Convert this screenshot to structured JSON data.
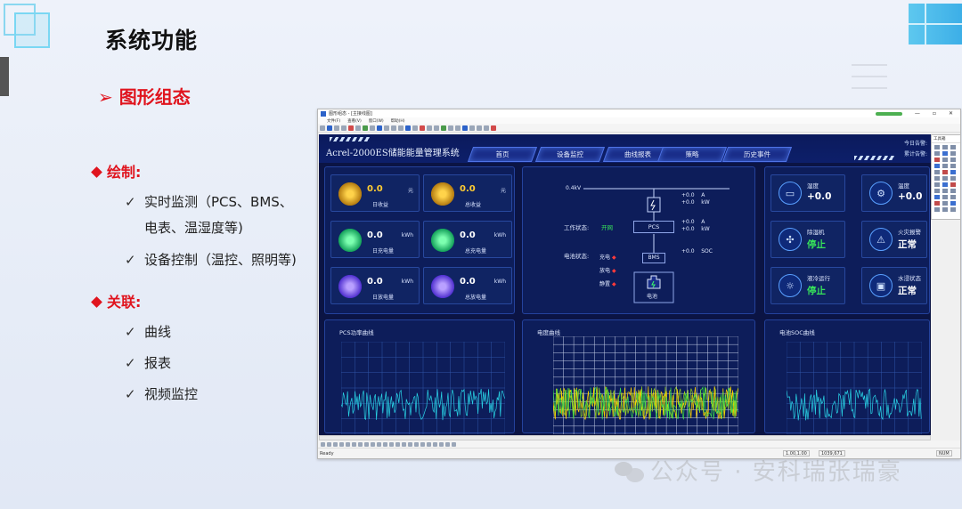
{
  "slide": {
    "title": "系统功能",
    "section": "➢ 图形组态",
    "bullets": [
      {
        "label": "绘制:",
        "items": [
          "实时监测（PCS、BMS、",
          "电表、温湿度等)",
          "设备控制（温控、照明等)"
        ]
      },
      {
        "label": "关联:",
        "items": [
          "曲线",
          "报表",
          "视频监控"
        ]
      }
    ],
    "check_mark": "✓",
    "watermark": "公众号 · 安科瑞张瑞豪"
  },
  "window": {
    "title": "图形组态 - [主接线图]",
    "menu": [
      "文件(F)",
      "查看(V)",
      "窗口(W)",
      "帮助(H)"
    ],
    "controls": [
      "—",
      "▫",
      "✕"
    ],
    "status": {
      "ready": "Ready",
      "coord1": "1.00,1.00",
      "coord2": "1039,671",
      "num": "NUM"
    },
    "palette_title": "工具箱"
  },
  "dashboard": {
    "title": "Acrel-2000ES储能能量管理系统",
    "tabs": [
      "首页",
      "设备监控",
      "曲线报表",
      "策略",
      "历史事件"
    ],
    "header_right": [
      "今日告警:",
      "累计告警:"
    ],
    "stat_cards": [
      {
        "value": "0.0",
        "unit": "元",
        "label": "日收益",
        "color": "#ffcc33"
      },
      {
        "value": "0.0",
        "unit": "元",
        "label": "总收益",
        "color": "#ffcc33"
      },
      {
        "value": "0.0",
        "unit": "kWh",
        "label": "日充电量",
        "color": "#ffffff"
      },
      {
        "value": "0.0",
        "unit": "kWh",
        "label": "总充电量",
        "color": "#ffffff"
      },
      {
        "value": "0.0",
        "unit": "kWh",
        "label": "日放电量",
        "color": "#ffffff"
      },
      {
        "value": "0.0",
        "unit": "kWh",
        "label": "总放电量",
        "color": "#ffffff"
      }
    ],
    "diagram": {
      "voltage": "0.4kV",
      "top_vals": [
        "+0.0",
        "+0.0"
      ],
      "top_units": [
        "A",
        "kW"
      ],
      "work_state_label": "工作状态:",
      "work_state_value": "开网",
      "pcs_label": "PCS",
      "mid_vals": [
        "+0.0",
        "+0.0"
      ],
      "mid_units": [
        "A",
        "kW"
      ],
      "battery_state_label": "电池状态:",
      "battery_states": [
        "充电",
        "放电",
        "静置"
      ],
      "bms_label": "BMS",
      "battery_label": "电池",
      "soc_value": "+0.0",
      "soc_unit": "SOC"
    },
    "right_cards": [
      {
        "label": "湿度",
        "value": "+0.0",
        "icon": "air-conditioner-icon",
        "green": false
      },
      {
        "label": "温度",
        "value": "+0.0",
        "icon": "thermometer-icon",
        "green": false
      },
      {
        "label": "除湿机",
        "value": "停止",
        "icon": "fan-icon",
        "green": true
      },
      {
        "label": "火灾报警",
        "value": "正常",
        "icon": "alarm-icon",
        "green": false
      },
      {
        "label": "液冷运行",
        "value": "停止",
        "icon": "cooling-icon",
        "green": true
      },
      {
        "label": "水浸状态",
        "value": "正常",
        "icon": "water-sensor-icon",
        "green": false
      }
    ],
    "charts": [
      {
        "title": "PCS功率曲线",
        "type": "line",
        "series_colors": [
          "#29d4e6"
        ]
      },
      {
        "title": "电度曲线",
        "type": "line",
        "series_colors": [
          "#9bd31c",
          "#ffd400",
          "#3bdc4a"
        ]
      },
      {
        "title": "电池SOC曲线",
        "type": "line",
        "series_colors": [
          "#29d4e6"
        ]
      }
    ]
  }
}
